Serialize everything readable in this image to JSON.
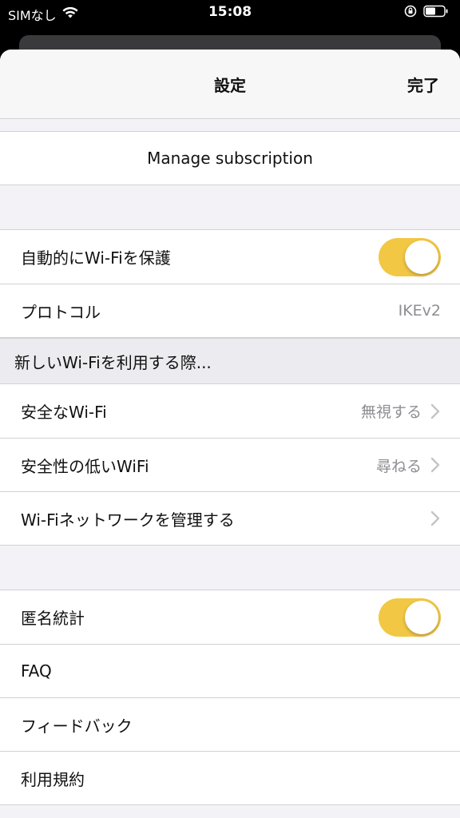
{
  "status_bar": {
    "carrier": "SIMなし",
    "time": "15:08"
  },
  "nav": {
    "title": "設定",
    "done_label": "完了"
  },
  "subscription": {
    "manage_label": "Manage subscription"
  },
  "protection": {
    "auto_protect_label": "自動的にWi-Fiを保護",
    "auto_protect_on": true,
    "protocol_label": "プロトコル",
    "protocol_value": "IKEv2"
  },
  "new_wifi_section": {
    "header": "新しいWi-Fiを利用する際...",
    "items": [
      {
        "label": "安全なWi-Fi",
        "value": "無視する"
      },
      {
        "label": "安全性の低いWiFi",
        "value": "尋ねる"
      },
      {
        "label": "Wi-Fiネットワークを管理する",
        "value": ""
      }
    ]
  },
  "misc": {
    "anonymous_stats_label": "匿名統計",
    "anonymous_stats_on": true,
    "faq_label": "FAQ",
    "feedback_label": "フィードバック",
    "terms_label": "利用規約"
  },
  "colors": {
    "toggle_on": "#f2c744",
    "secondary_text": "#8e8e93",
    "background": "#f2f2f7"
  },
  "icons": {
    "wifi": "wifi-icon",
    "lock_rotation": "orientation-lock-icon",
    "battery": "battery-icon",
    "chevron": "chevron-right-icon"
  }
}
